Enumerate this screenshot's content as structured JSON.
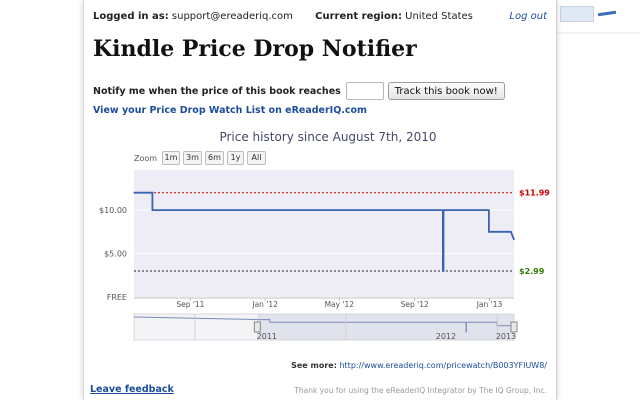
{
  "header": {
    "logged_in_label": "Logged in as:",
    "logged_in_email": "support@ereaderiq.com",
    "region_label": "Current region:",
    "region_value": "United States",
    "logout": "Log out"
  },
  "title": "Kindle Price Drop Notifier",
  "notify": {
    "label": "Notify me when the price of this book reaches",
    "input_value": "",
    "input_placeholder": "",
    "button": "Track this book now!"
  },
  "watch_list_link": "View your Price Drop Watch List on eReaderIQ.com",
  "zoom": {
    "label": "Zoom",
    "options": [
      "1m",
      "3m",
      "6m",
      "1y",
      "All"
    ]
  },
  "chart_data": {
    "type": "line",
    "title": "Price history since August 7th, 2010",
    "x_start": "2011-06-01",
    "x_end": "2013-02-10",
    "ylim": [
      0,
      14.6
    ],
    "y_ticks": [
      {
        "value": 10,
        "label": "$10.00"
      },
      {
        "value": 5,
        "label": "$5.00"
      },
      {
        "value": 0,
        "label": "FREE"
      }
    ],
    "x_ticks": [
      {
        "date": "2011-09-01",
        "label": "Sep '11"
      },
      {
        "date": "2012-01-01",
        "label": "Jan '12"
      },
      {
        "date": "2012-05-01",
        "label": "May '12"
      },
      {
        "date": "2012-09-01",
        "label": "Sep '12"
      },
      {
        "date": "2013-01-01",
        "label": "Jan '13"
      }
    ],
    "series": [
      {
        "name": "",
        "color": "#3a64b0",
        "points": [
          {
            "x": "2011-06-01",
            "y": 11.99
          },
          {
            "x": "2011-07-01",
            "y": 11.99
          },
          {
            "x": "2011-07-01",
            "y": 9.99
          },
          {
            "x": "2012-10-17",
            "y": 9.99
          },
          {
            "x": "2012-10-17",
            "y": 2.99
          },
          {
            "x": "2012-10-18",
            "y": 2.99
          },
          {
            "x": "2012-10-18",
            "y": 9.99
          },
          {
            "x": "2012-12-31",
            "y": 9.99
          },
          {
            "x": "2012-12-31",
            "y": 7.5
          },
          {
            "x": "2013-02-05",
            "y": 7.5
          },
          {
            "x": "2013-02-10",
            "y": 6.6
          }
        ]
      }
    ],
    "reference_lines": [
      {
        "value": 11.99,
        "label": "$11.99",
        "color": "#cc0000"
      },
      {
        "value": 2.99,
        "label": "$2.99",
        "color": "#2e7d00"
      }
    ],
    "navigator": {
      "labels": [
        {
          "date": "2011-01-01",
          "label": "2011"
        },
        {
          "date": "2012-01-01",
          "label": "2012"
        },
        {
          "date": "2013-01-01",
          "label": "2013"
        }
      ]
    }
  },
  "see_more": {
    "label": "See more:",
    "url": "http://www.ereaderiq.com/pricewatch/B003YFIUW8/"
  },
  "feedback_link": "Leave feedback",
  "footer": "Thank you for using the eReaderIQ Integrator by The IQ Group, Inc.",
  "colors": {
    "link": "#1a4d9c",
    "series": "#3a64b0",
    "plot_fill": "#eeedf5",
    "high_ref": "#cc0000",
    "low_ref": "#2e7d00"
  }
}
